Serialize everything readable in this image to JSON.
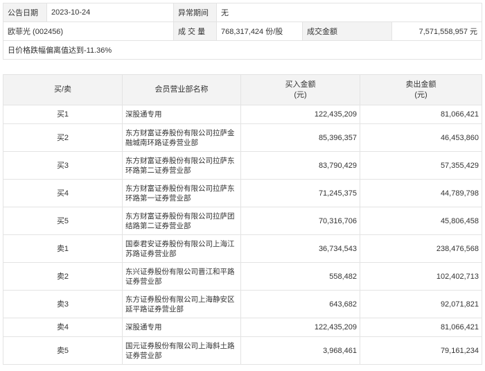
{
  "info": {
    "date_label": "公告日期",
    "date_value": "2023-10-24",
    "period_label": "异常期间",
    "period_value": "无",
    "stock_name": "欧菲光 (002456)",
    "volume_label": "成 交 量",
    "volume_value": "768,317,424 份/股",
    "amount_label": "成交金额",
    "amount_value": "7,571,558,957 元",
    "reason": "日价格跌幅偏离值达到-11.36%"
  },
  "table": {
    "headers": {
      "side": "买/卖",
      "broker": "会员营业部名称",
      "buy": "买入金额",
      "buy_unit": "(元)",
      "sell": "卖出金额",
      "sell_unit": "(元)"
    },
    "rows": [
      {
        "side": "买1",
        "broker": "深股通专用",
        "buy": "122,435,209",
        "sell": "81,066,421"
      },
      {
        "side": "买2",
        "broker": "东方财富证券股份有限公司拉萨金融城南环路证券营业部",
        "buy": "85,396,357",
        "sell": "46,453,860"
      },
      {
        "side": "买3",
        "broker": "东方财富证券股份有限公司拉萨东环路第二证券营业部",
        "buy": "83,790,429",
        "sell": "57,355,429"
      },
      {
        "side": "买4",
        "broker": "东方财富证券股份有限公司拉萨东环路第一证券营业部",
        "buy": "71,245,375",
        "sell": "44,789,798"
      },
      {
        "side": "买5",
        "broker": "东方财富证券股份有限公司拉萨团结路第二证券营业部",
        "buy": "70,316,706",
        "sell": "45,806,458"
      },
      {
        "side": "卖1",
        "broker": "国泰君安证券股份有限公司上海江苏路证券营业部",
        "buy": "36,734,543",
        "sell": "238,476,568"
      },
      {
        "side": "卖2",
        "broker": "东兴证券股份有限公司晋江和平路证券营业部",
        "buy": "558,482",
        "sell": "102,402,713"
      },
      {
        "side": "卖3",
        "broker": "东方证券股份有限公司上海静安区延平路证券营业部",
        "buy": "643,682",
        "sell": "92,071,821"
      },
      {
        "side": "卖4",
        "broker": "深股通专用",
        "buy": "122,435,209",
        "sell": "81,066,421"
      },
      {
        "side": "卖5",
        "broker": "国元证券股份有限公司上海斜土路证券营业部",
        "buy": "3,968,461",
        "sell": "79,161,234"
      }
    ]
  }
}
